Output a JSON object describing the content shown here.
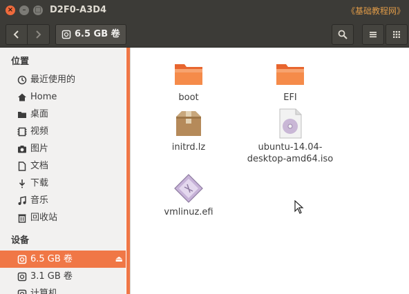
{
  "window": {
    "title": "D2F0-A3D4",
    "watermark": "《基础教程网》",
    "close_glyph": "×",
    "min_glyph": "–",
    "max_glyph": "□"
  },
  "toolbar": {
    "back_glyph": "‹",
    "forward_glyph": "›",
    "path_label": "6.5 GB 卷",
    "search_icon": "search-icon",
    "list_icon": "list-view-icon",
    "grid_icon": "grid-view-icon"
  },
  "sidebar": {
    "places_header": "位置",
    "places": [
      {
        "label": "最近使用的",
        "icon": "recent-icon"
      },
      {
        "label": "Home",
        "icon": "home-icon"
      },
      {
        "label": "桌面",
        "icon": "desktop-folder-icon"
      },
      {
        "label": "视频",
        "icon": "video-icon"
      },
      {
        "label": "图片",
        "icon": "camera-icon"
      },
      {
        "label": "文档",
        "icon": "document-icon"
      },
      {
        "label": "下载",
        "icon": "download-icon"
      },
      {
        "label": "音乐",
        "icon": "music-icon"
      },
      {
        "label": "回收站",
        "icon": "trash-icon"
      }
    ],
    "devices_header": "设备",
    "devices": [
      {
        "label": "6.5 GB 卷",
        "icon": "drive-icon",
        "active": true,
        "eject": "⏏"
      },
      {
        "label": "3.1 GB 卷",
        "icon": "drive-icon",
        "active": false
      },
      {
        "label": "计算机",
        "icon": "computer-icon",
        "active": false
      }
    ]
  },
  "files": [
    {
      "name": "boot",
      "icon": "orange-folder-icon"
    },
    {
      "name": "EFI",
      "icon": "orange-folder-icon"
    },
    {
      "name": "initrd.lz",
      "icon": "archive-box-icon"
    },
    {
      "name_line1": "ubuntu-14.04-",
      "name_line2": "desktop-amd64.iso",
      "icon": "disc-image-icon"
    },
    {
      "name": "vmlinuz.efi",
      "icon": "executable-file-icon"
    }
  ],
  "colors": {
    "accent": "#f07746",
    "titlebar": "#3c3b37",
    "sidebar_bg": "#f2f1f0"
  }
}
